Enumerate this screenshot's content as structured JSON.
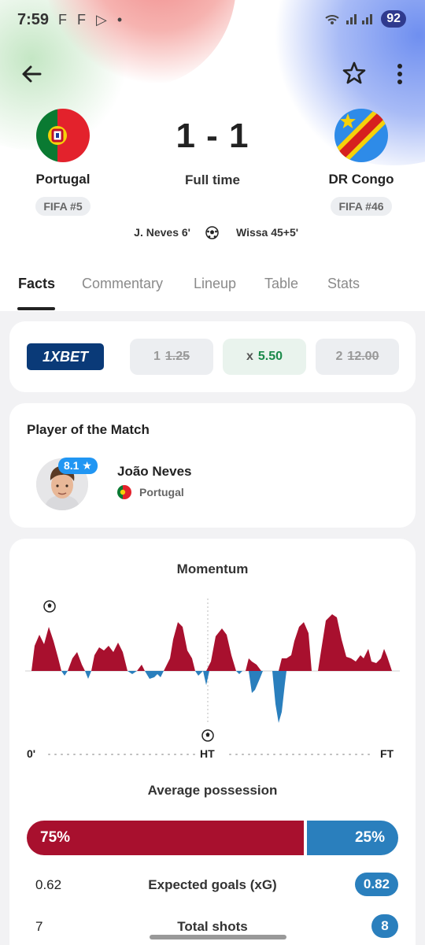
{
  "status_bar": {
    "time": "7:59",
    "notifications": "F F ▷ •",
    "battery": "92"
  },
  "header": {
    "back_icon": "arrow-left-icon",
    "favorite_icon": "star-outline-icon",
    "more_icon": "more-vertical-icon"
  },
  "match": {
    "home": {
      "name": "Portugal",
      "fifa_rank": "FIFA #5"
    },
    "away": {
      "name": "DR Congo",
      "fifa_rank": "FIFA #46"
    },
    "score": "1 - 1",
    "status": "Full time",
    "scorers": {
      "home": "J. Neves 6'",
      "away": "Wissa 45+5'"
    }
  },
  "tabs": [
    {
      "label": "Facts",
      "active": true
    },
    {
      "label": "Commentary",
      "active": false
    },
    {
      "label": "Lineup",
      "active": false
    },
    {
      "label": "Table",
      "active": false
    },
    {
      "label": "Stats",
      "active": false
    }
  ],
  "odds": {
    "bookmaker": "1XBET",
    "home": {
      "label": "1",
      "value": "1.25"
    },
    "draw": {
      "label": "x",
      "value": "5.50"
    },
    "away": {
      "label": "2",
      "value": "12.00"
    }
  },
  "player_of_match": {
    "title": "Player of the Match",
    "name": "João Neves",
    "team": "Portugal",
    "rating": "8.1 ★"
  },
  "momentum": {
    "title": "Momentum",
    "axis": {
      "start": "0'",
      "half": "HT",
      "end": "FT"
    }
  },
  "possession": {
    "title": "Average possession",
    "home": "75%",
    "away": "25%",
    "home_pct": 75
  },
  "stats": [
    {
      "label": "Expected goals (xG)",
      "home": "0.62",
      "away": "0.82"
    },
    {
      "label": "Total shots",
      "home": "7",
      "away": "8"
    }
  ],
  "colors": {
    "home": "#a8102e",
    "away": "#2a7fbd",
    "odds_highlight": "#1a8a4a",
    "bookmaker_bg": "#0a3a78"
  }
}
